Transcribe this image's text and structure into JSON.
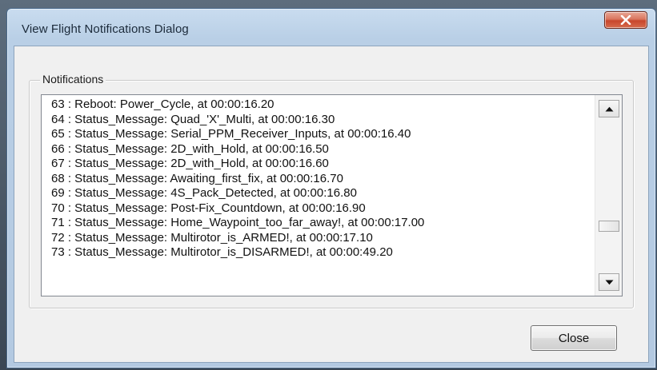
{
  "window": {
    "title": "View Flight Notifications Dialog"
  },
  "group": {
    "label": "Notifications"
  },
  "notifications": [
    "63 : Reboot: Power_Cycle, at 00:00:16.20",
    "64 : Status_Message: Quad_'X'_Multi, at 00:00:16.30",
    "65 : Status_Message: Serial_PPM_Receiver_Inputs, at 00:00:16.40",
    "66 : Status_Message: 2D_with_Hold, at 00:00:16.50",
    "67 : Status_Message: 2D_with_Hold, at 00:00:16.60",
    "68 : Status_Message: Awaiting_first_fix, at 00:00:16.70",
    "69 : Status_Message: 4S_Pack_Detected, at 00:00:16.80",
    "70 : Status_Message: Post-Fix_Countdown, at 00:00:16.90",
    "71 : Status_Message: Home_Waypoint_too_far_away!, at 00:00:17.00",
    "72 : Status_Message: Multirotor_is_ARMED!, at 00:00:17.10",
    "73 : Status_Message: Multirotor_is_DISARMED!, at 00:00:49.20"
  ],
  "scroll": {
    "position_fraction": 0.72
  },
  "buttons": {
    "close_label": "Close"
  },
  "icons": {
    "window_close": "close-icon",
    "scroll_up": "arrow-up-icon",
    "scroll_down": "arrow-down-icon"
  },
  "colors": {
    "title_close_button": "#c8462c",
    "dialog_background": "#f0f0f0"
  }
}
